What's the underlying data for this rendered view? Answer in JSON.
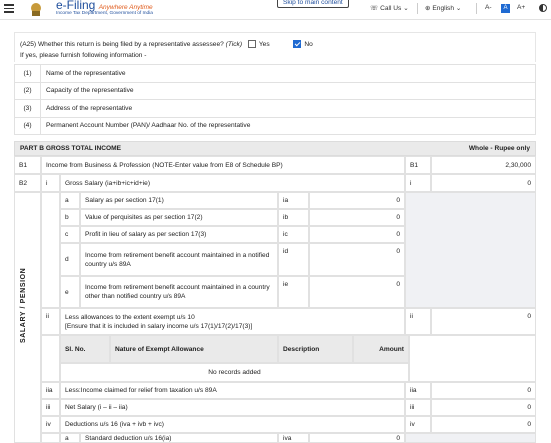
{
  "header": {
    "brand_main": "e-Filing",
    "brand_tag": "Anywhere Anytime",
    "brand_sub": "Income Tax Department, Government of India",
    "skip_link": "Skip to main content",
    "call_us": "Call Us",
    "language": "English",
    "font_decrease": "A-",
    "font_normal": "A",
    "font_increase": "A+"
  },
  "question": {
    "text": "(A25) Whether this return is being filed by a representative assessee?",
    "tick_hint": "(Tick)",
    "yes_label": "Yes",
    "no_label": "No",
    "yes_checked": false,
    "no_checked": true,
    "followup": "If yes, please furnish following information -"
  },
  "representative_rows": [
    {
      "num": "(1)",
      "label": "Name of the representative"
    },
    {
      "num": "(2)",
      "label": "Capacity of the representative"
    },
    {
      "num": "(3)",
      "label": "Address of the representative"
    },
    {
      "num": "(4)",
      "label": "Permanent Account Number (PAN)/ Aadhaar No. of the representative"
    }
  ],
  "partb": {
    "title": "PART B GROSS TOTAL INCOME",
    "unit": "Whole - Rupee only",
    "b1": {
      "code": "B1",
      "label": "Income from Business & Profession (NOTE-Enter value from E8 of Schedule BP)",
      "ref": "B1",
      "value": "2,30,000"
    },
    "b2": {
      "code": "B2",
      "sub": "i",
      "label": "Gross Salary (ia+ib+ic+id+ie)",
      "ref": "i",
      "value": "0"
    },
    "side_label": "SALARY / PENSION",
    "salary_items": [
      {
        "letter": "a",
        "label": "Salary as per section 17(1)",
        "ref": "ia",
        "value": "0"
      },
      {
        "letter": "b",
        "label": "Value of perquisites as per section 17(2)",
        "ref": "ib",
        "value": "0"
      },
      {
        "letter": "c",
        "label": "Profit in lieu of salary as per section 17(3)",
        "ref": "ic",
        "value": "0"
      },
      {
        "letter": "d",
        "label": "Income from retirement benefit account maintained in a notified country u/s 89A",
        "ref": "id",
        "value": "0"
      },
      {
        "letter": "e",
        "label": "Income from retirement benefit account maintained in a country other than notified country u/s 89A",
        "ref": "ie",
        "value": "0"
      }
    ],
    "allowances": {
      "code": "ii",
      "label1": "Less allowances to the extent exempt u/s 10",
      "label2": "[Ensure that it is included in salary income u/s 17(1)/17(2)/17(3)]",
      "ref": "ii",
      "value": "0"
    },
    "exempt_table": {
      "col_sl": "Sl. No.",
      "col_nature": "Nature of Exempt Allowance",
      "col_desc": "Description",
      "col_amount": "Amount",
      "empty": "No records added"
    },
    "rows_after": [
      {
        "code": "iia",
        "label": "Less:Income claimed for relief from taxation u/s 89A",
        "ref": "iia",
        "value": "0"
      },
      {
        "code": "iii",
        "label": "Net Salary (i – ii – iia)",
        "ref": "iii",
        "value": "0"
      },
      {
        "code": "iv",
        "label": "Deductions u/s 16 (iva + ivb + ivc)",
        "ref": "iv",
        "value": "0"
      }
    ],
    "deduction_a": {
      "letter": "a",
      "label": "Standard deduction u/s 16(ia)",
      "ref": "iva",
      "value": "0"
    }
  }
}
